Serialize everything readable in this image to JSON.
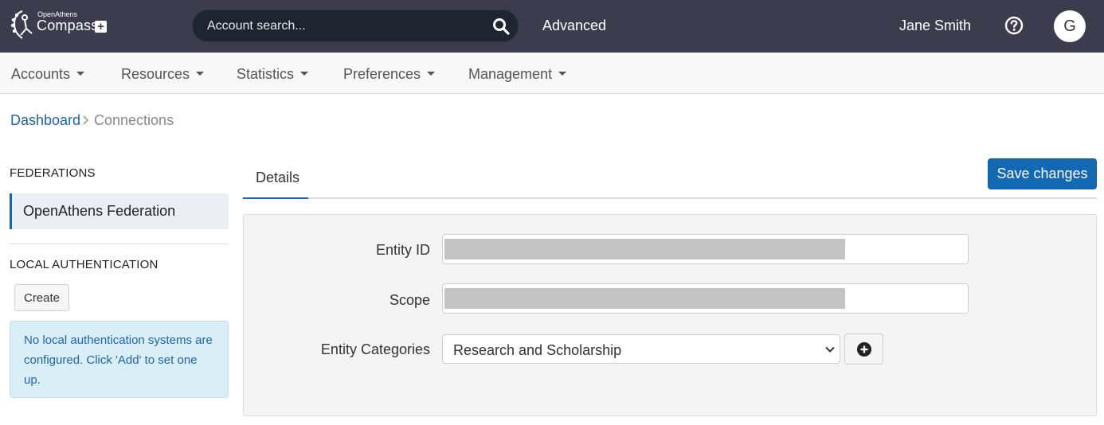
{
  "header": {
    "logo_small": "OpenAthens",
    "logo_big": "Compass",
    "logo_plus": "+",
    "search_placeholder": "Account search...",
    "advanced_label": "Advanced",
    "user_name": "Jane Smith",
    "avatar_initial": "G",
    "bg_color": "#3d3c4e"
  },
  "menu": {
    "items": [
      "Accounts",
      "Resources",
      "Statistics",
      "Preferences",
      "Management"
    ]
  },
  "breadcrumb": {
    "home": "Dashboard",
    "current": "Connections"
  },
  "sidebar": {
    "federations_heading": "FEDERATIONS",
    "federation_item": "OpenAthens Federation",
    "local_auth_heading": "LOCAL AUTHENTICATION",
    "create_label": "Create",
    "info_message": "No local authentication systems are configured. Click 'Add' to set one up."
  },
  "main": {
    "tab_label": "Details",
    "save_label": "Save changes",
    "fields": {
      "entity_id_label": "Entity ID",
      "scope_label": "Scope",
      "categories_label": "Entity Categories",
      "categories_value": "Research and Scholarship"
    }
  },
  "colors": {
    "accent": "#1368b3",
    "link": "#1d64a8"
  }
}
